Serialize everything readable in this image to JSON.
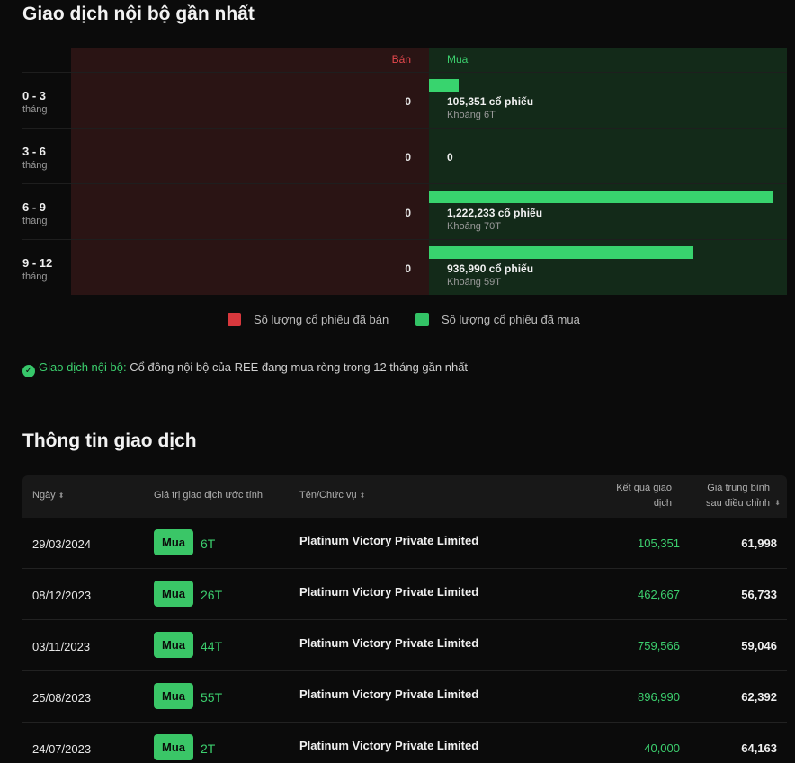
{
  "insider_section": {
    "title": "Giao dịch nội bộ gần nhất",
    "sell_header": "Bán",
    "buy_header": "Mua",
    "rows": [
      {
        "period": "0 - 3",
        "unit": "tháng",
        "sell_value": "0",
        "buy_qty": "105,351 cổ phiếu",
        "buy_approx": "Khoảng 6T",
        "buy_fraction": 0.086
      },
      {
        "period": "3 - 6",
        "unit": "tháng",
        "sell_value": "0",
        "buy_qty": "0",
        "buy_approx": "",
        "buy_fraction": 0
      },
      {
        "period": "6 - 9",
        "unit": "tháng",
        "sell_value": "0",
        "buy_qty": "1,222,233 cổ phiếu",
        "buy_approx": "Khoảng 70T",
        "buy_fraction": 1.0
      },
      {
        "period": "9 - 12",
        "unit": "tháng",
        "sell_value": "0",
        "buy_qty": "936,990 cổ phiếu",
        "buy_approx": "Khoảng 59T",
        "buy_fraction": 0.767
      }
    ],
    "legend": {
      "sell_label": "Số lượng cổ phiếu đã bán",
      "buy_label": "Số lượng cổ phiếu đã mua"
    },
    "note_highlight": "Giao dịch nội bộ:",
    "note_text": "Cổ đông nội bộ của REE đang mua ròng trong 12 tháng gần nhất"
  },
  "trade_info": {
    "title": "Thông tin giao dịch",
    "headers": {
      "date": "Ngày",
      "value": "Giá trị giao dịch ước tính",
      "name": "Tên/Chức vụ",
      "result_line1": "Kết quả giao",
      "result_line2": "dịch",
      "avg_line1": "Giá trung bình",
      "avg_line2": "sau điều chỉnh"
    },
    "rows": [
      {
        "date": "29/03/2024",
        "badge": "Mua",
        "amount": "6T",
        "name": "Platinum Victory Private Limited",
        "result": "105,351",
        "avg": "61,998"
      },
      {
        "date": "08/12/2023",
        "badge": "Mua",
        "amount": "26T",
        "name": "Platinum Victory Private Limited",
        "result": "462,667",
        "avg": "56,733"
      },
      {
        "date": "03/11/2023",
        "badge": "Mua",
        "amount": "44T",
        "name": "Platinum Victory Private Limited",
        "result": "759,566",
        "avg": "59,046"
      },
      {
        "date": "25/08/2023",
        "badge": "Mua",
        "amount": "55T",
        "name": "Platinum Victory Private Limited",
        "result": "896,990",
        "avg": "62,392"
      },
      {
        "date": "24/07/2023",
        "badge": "Mua",
        "amount": "2T",
        "name": "Platinum Victory Private Limited",
        "result": "40,000",
        "avg": "64,163"
      }
    ]
  },
  "colors": {
    "sell_bg": "#2a1414",
    "buy_bg": "#132a19",
    "buy_bar": "#38d46e",
    "accent_green": "#3ccf6e",
    "accent_red": "#e5484d"
  }
}
